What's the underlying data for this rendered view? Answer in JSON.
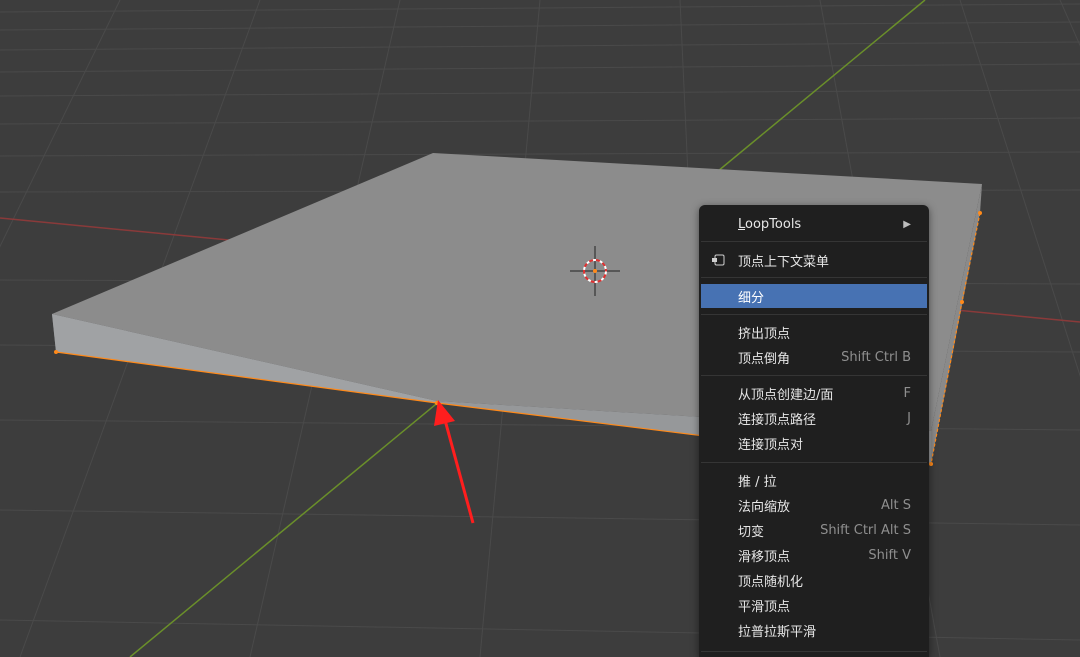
{
  "menu": {
    "items": [
      {
        "label": "LoopTools",
        "shortcut": "",
        "submenu_arrow": "▶"
      },
      {
        "label": "顶点上下文菜单",
        "shortcut": "",
        "icon": "vertex-context-icon"
      },
      {
        "label": "细分",
        "shortcut": "",
        "active": true
      },
      {
        "label": "挤出顶点",
        "shortcut": ""
      },
      {
        "label": "顶点倒角",
        "shortcut": "Shift Ctrl B"
      },
      {
        "label": "从顶点创建边/面",
        "shortcut": "F"
      },
      {
        "label": "连接顶点路径",
        "shortcut": "J"
      },
      {
        "label": "连接顶点对",
        "shortcut": ""
      },
      {
        "label": "推 / 拉",
        "shortcut": ""
      },
      {
        "label": "法向缩放",
        "shortcut": "Alt S"
      },
      {
        "label": "切变",
        "shortcut": "Shift Ctrl Alt S"
      },
      {
        "label": "滑移顶点",
        "shortcut": "Shift V"
      },
      {
        "label": "顶点随机化",
        "shortcut": ""
      },
      {
        "label": "平滑顶点",
        "shortcut": ""
      },
      {
        "label": "拉普拉斯平滑",
        "shortcut": ""
      }
    ]
  },
  "colors": {
    "viewport_bg": "#3d3d3d",
    "grid": "#4a4a4a",
    "x_axis": "#8a3a3a",
    "y_axis": "#6a8f2a",
    "selection": "#ff8a1a",
    "menu_active": "#4772b3",
    "annotation_arrow": "#ff1e1e"
  }
}
